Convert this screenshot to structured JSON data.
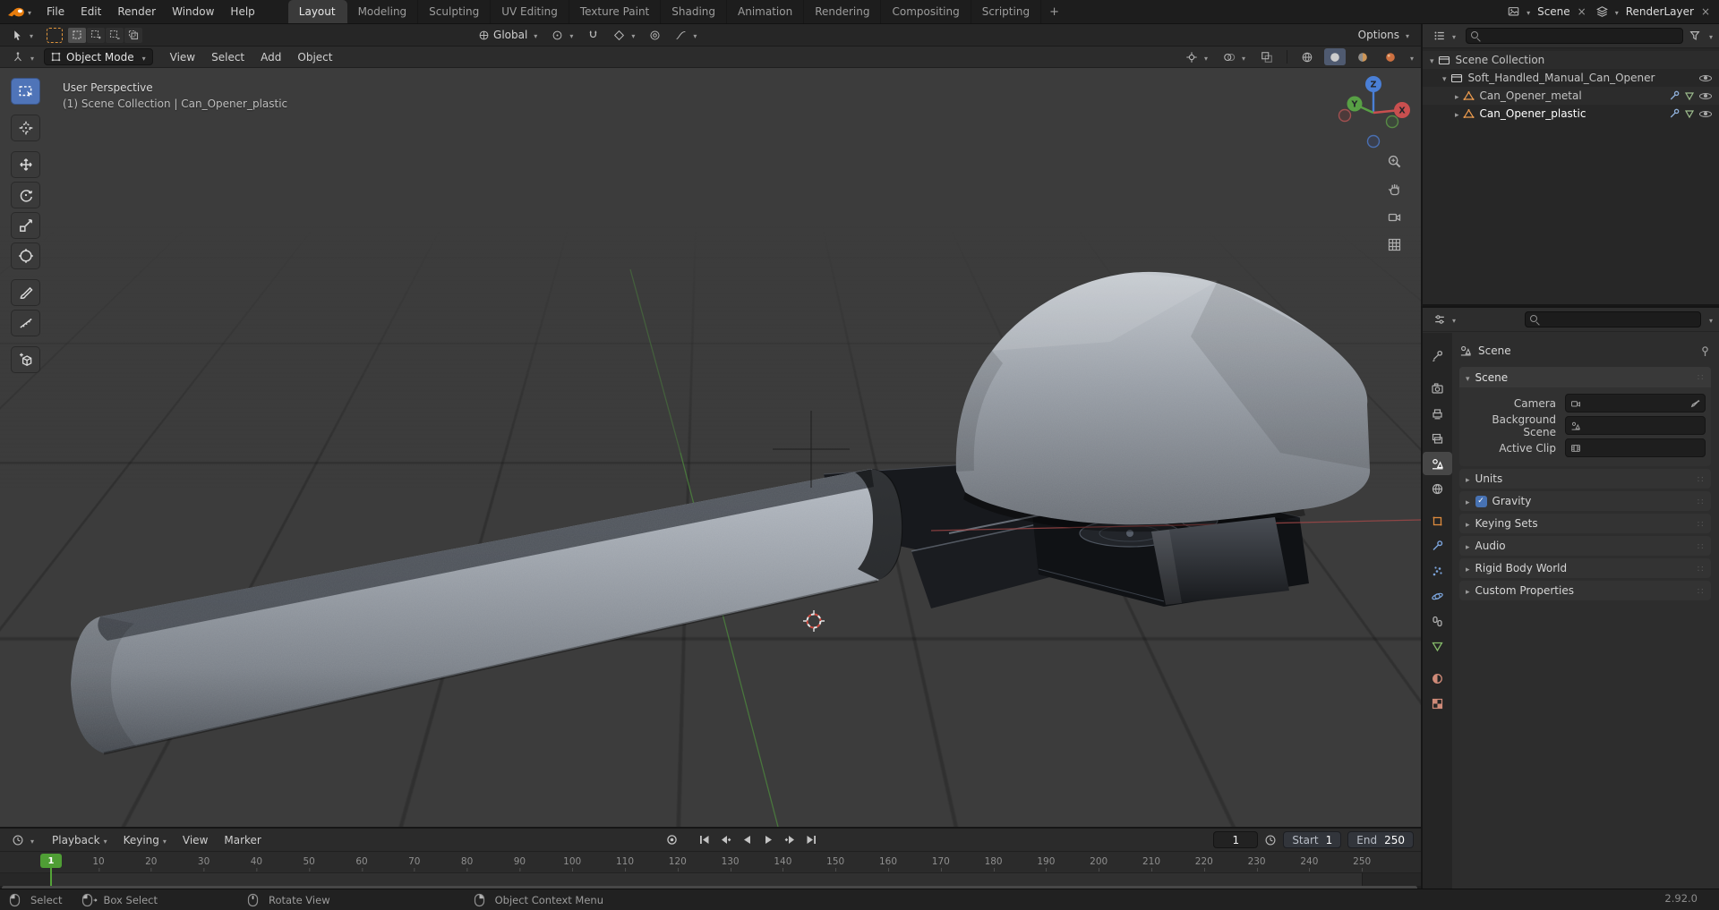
{
  "colors": {
    "accent": "#4772b3",
    "active_tool": "#4f74b8",
    "axis_x": "#a34848",
    "axis_y": "#4e8a3e",
    "axis_z": "#4a7fd6",
    "frame_marker_green": "#4f9e35",
    "mesh_icon_orange": "#ec9b4e",
    "blender_orange": "#e87d0d"
  },
  "topbar": {
    "logo_icon": "blender-logo-icon",
    "menus": [
      {
        "label": "File"
      },
      {
        "label": "Edit"
      },
      {
        "label": "Render"
      },
      {
        "label": "Window"
      },
      {
        "label": "Help"
      }
    ],
    "tabs": [
      {
        "label": "Layout",
        "state": "active"
      },
      {
        "label": "Modeling"
      },
      {
        "label": "Sculpting"
      },
      {
        "label": "UV Editing"
      },
      {
        "label": "Texture Paint"
      },
      {
        "label": "Shading"
      },
      {
        "label": "Animation"
      },
      {
        "label": "Rendering"
      },
      {
        "label": "Compositing"
      },
      {
        "label": "Scripting"
      }
    ],
    "new_tab_label": "+",
    "scene_selector": {
      "icon": "scene-photo-icon",
      "label": "Scene",
      "close": "×"
    },
    "view_layer_selector": {
      "icon": "view-layers-icon",
      "label": "RenderLayer",
      "close": "×"
    }
  },
  "tool_settings": {
    "tool_icon": "box-select-tool-icon",
    "mode_icons": [
      "mode-set",
      "mode-extend",
      "mode-subtract",
      "mode-invert"
    ],
    "orientation_label": "Global",
    "pivot_icon": "pivot-point-icon",
    "snap_icon": "magnet-icon",
    "proportional_icon": "proportional-editing-icon",
    "options_label": "Options"
  },
  "view_header": {
    "editor_icon": "3d-viewport-icon",
    "mode_label": "Object Mode",
    "menus": [
      {
        "label": "View"
      },
      {
        "label": "Select"
      },
      {
        "label": "Add"
      },
      {
        "label": "Object"
      }
    ],
    "right_icons": [
      "gizmo-icon",
      "overlays-icon",
      "xray-icon"
    ],
    "shading_modes": [
      "wireframe",
      "solid",
      "material-preview",
      "rendered"
    ],
    "shading_active": "solid"
  },
  "viewport": {
    "view_label": "User Perspective",
    "context_label": "(1) Scene Collection | Can_Opener_plastic",
    "gizmo_axes": {
      "x": "X",
      "y": "Y",
      "z": "Z"
    },
    "tools": [
      "box-select",
      "cursor",
      "move",
      "rotate",
      "scale",
      "transform",
      "annotate",
      "measure",
      "add-cube"
    ],
    "active_tool": "box-select",
    "nav_icons": [
      "zoom-icon",
      "pan-hand-icon",
      "camera-view-icon",
      "toggle-ortho-icon"
    ]
  },
  "outliner": {
    "search_placeholder": "",
    "rows": [
      {
        "label": "Scene Collection",
        "icon": "collection-icon",
        "depth": 0
      },
      {
        "label": "Soft_Handled_Manual_Can_Opener",
        "icon": "collection-icon",
        "depth": 1,
        "eye": true
      },
      {
        "label": "Can_Opener_metal",
        "icon": "mesh-icon",
        "depth": 2,
        "eye": true
      },
      {
        "label": "Can_Opener_plastic",
        "icon": "mesh-icon",
        "depth": 2,
        "eye": true,
        "state": "active"
      }
    ]
  },
  "properties": {
    "breadcrumb": "Scene",
    "nav_tabs": [
      {
        "name": "tool"
      },
      {
        "name": "render"
      },
      {
        "name": "output"
      },
      {
        "name": "view-layer"
      },
      {
        "name": "scene",
        "state": "active"
      },
      {
        "name": "world"
      },
      {
        "name": "object"
      },
      {
        "name": "modifiers"
      },
      {
        "name": "particles"
      },
      {
        "name": "physics"
      },
      {
        "name": "constraints"
      },
      {
        "name": "object-data"
      },
      {
        "name": "material"
      },
      {
        "name": "texture"
      }
    ],
    "scene_panel": {
      "title": "Scene",
      "fields": [
        {
          "label": "Camera"
        },
        {
          "label": "Background Scene"
        },
        {
          "label": "Active Clip"
        }
      ]
    },
    "collapsed_panels": [
      {
        "label": "Units"
      },
      {
        "label": "Gravity",
        "check": true
      },
      {
        "label": "Keying Sets"
      },
      {
        "label": "Audio"
      },
      {
        "label": "Rigid Body World"
      },
      {
        "label": "Custom Properties"
      }
    ]
  },
  "timeline": {
    "editor_icon": "clock-icon",
    "menus": [
      {
        "label": "Playback",
        "caret": true
      },
      {
        "label": "Keying",
        "caret": true
      },
      {
        "label": "View"
      },
      {
        "label": "Marker"
      }
    ],
    "transport": [
      "auto-key",
      "jump-start",
      "prev-keyframe",
      "play-reverse",
      "play",
      "next-keyframe",
      "jump-end"
    ],
    "current_frame": "1",
    "marker_label": "1",
    "start": {
      "label": "Start",
      "value": "1"
    },
    "end": {
      "label": "End",
      "value": "250"
    },
    "ticks": [
      "10",
      "20",
      "30",
      "40",
      "50",
      "60",
      "70",
      "80",
      "90",
      "100",
      "110",
      "120",
      "130",
      "140",
      "150",
      "160",
      "170",
      "180",
      "190",
      "200",
      "210",
      "220",
      "230",
      "240",
      "250"
    ]
  },
  "status": {
    "items": [
      {
        "label": "Select",
        "icon": "mouse-left"
      },
      {
        "label": "Box Select",
        "icon": "mouse-left-drag"
      },
      {
        "label": "Rotate View",
        "icon": "mouse-middle"
      },
      {
        "label": "Object Context Menu",
        "icon": "mouse-right"
      }
    ],
    "version": "2.92.0"
  }
}
